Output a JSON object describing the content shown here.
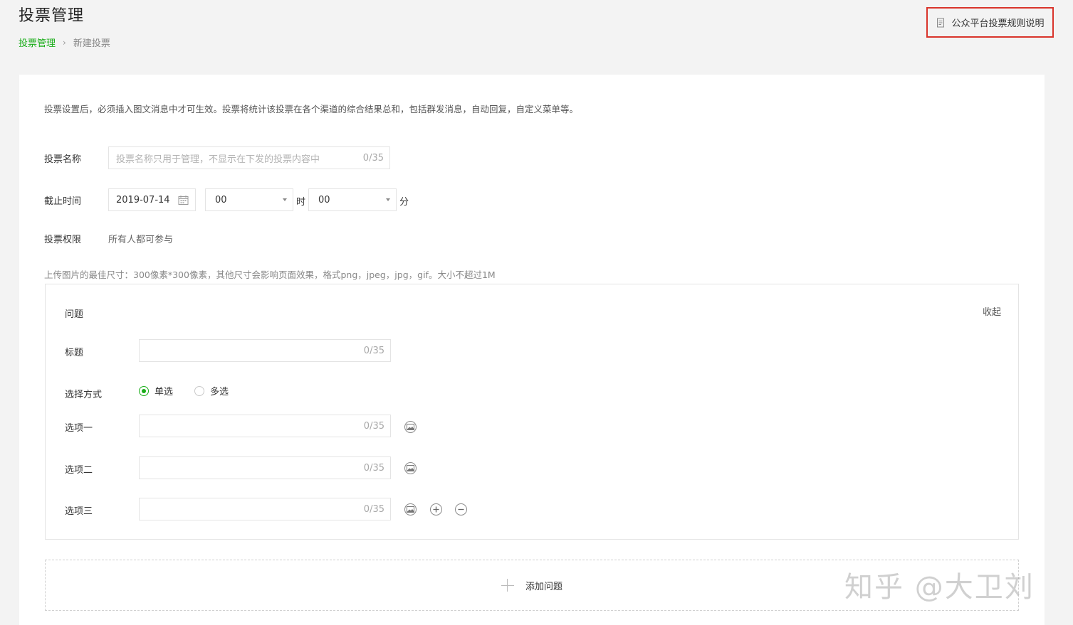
{
  "header": {
    "title": "投票管理",
    "breadcrumb": {
      "parent": "投票管理",
      "separator": "›",
      "current": "新建投票"
    },
    "rules_link": "公众平台投票规则说明"
  },
  "form": {
    "notice": "投票设置后，必须插入图文消息中才可生效。投票将统计该投票在各个渠道的综合结果总和，包括群发消息，自动回复，自定义菜单等。",
    "name": {
      "label": "投票名称",
      "placeholder": "投票名称只用于管理，不显示在下发的投票内容中",
      "counter": "0/35"
    },
    "deadline": {
      "label": "截止时间",
      "date": "2019-07-14",
      "hour": "00",
      "hour_unit": "时",
      "minute": "00",
      "minute_unit": "分"
    },
    "permission": {
      "label": "投票权限",
      "value": "所有人都可参与"
    },
    "upload_tip": "上传图片的最佳尺寸：300像素*300像素，其他尺寸会影响页面效果，格式png，jpeg，jpg，gif。大小不超过1M"
  },
  "question": {
    "heading": "问题",
    "collapse": "收起",
    "title_label": "标题",
    "title_counter": "0/35",
    "mode_label": "选择方式",
    "single": "单选",
    "multiple": "多选",
    "selected_mode": "单选",
    "options": [
      {
        "label": "选项一",
        "counter": "0/35"
      },
      {
        "label": "选项二",
        "counter": "0/35"
      },
      {
        "label": "选项三",
        "counter": "0/35"
      }
    ]
  },
  "add_question": "添加问题",
  "watermark": "知乎 @大卫刘",
  "colors": {
    "accent": "#1aad19",
    "highlight_border": "#d9342b"
  }
}
